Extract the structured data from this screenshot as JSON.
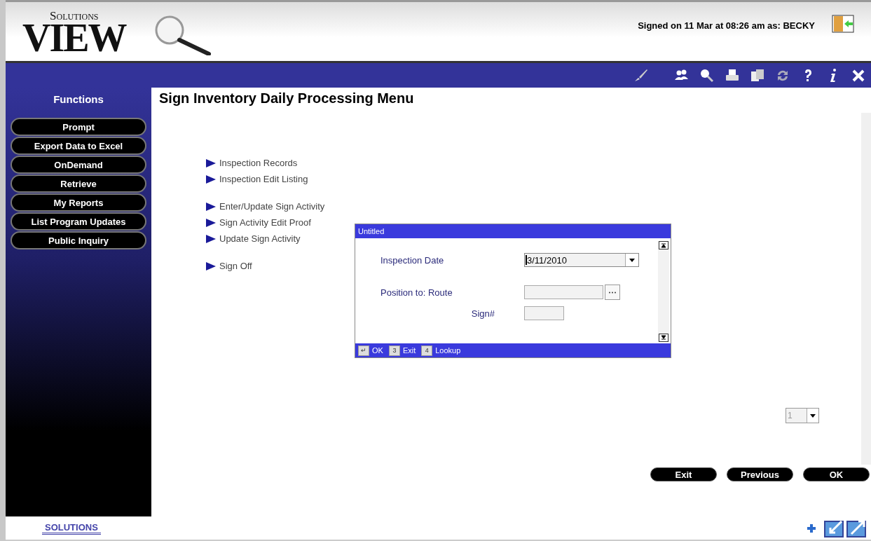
{
  "header": {
    "logo_small": "Solutions",
    "logo_big": "VIEW",
    "signed_on": "Signed on 11 Mar at 08:26 am as: BECKY"
  },
  "sidebar": {
    "title": "Functions",
    "items": [
      "Prompt",
      "Export Data to Excel",
      "OnDemand",
      "Retrieve",
      "My Reports",
      "List Program Updates",
      "Public Inquiry"
    ]
  },
  "page": {
    "title": "Sign Inventory Daily Processing Menu",
    "menu_groups": [
      [
        "Inspection Records",
        "Inspection Edit Listing"
      ],
      [
        "Enter/Update Sign Activity",
        "Sign Activity Edit Proof",
        "Update Sign Activity"
      ],
      [
        "Sign Off"
      ]
    ],
    "page_select": "1",
    "buttons": [
      "Exit",
      "Previous",
      "OK"
    ]
  },
  "dialog": {
    "title": "Untitled",
    "fields": [
      {
        "kind": "dropdown",
        "label": "Inspection Date",
        "value": "3/11/2010"
      },
      {
        "kind": "lookup",
        "label": "Position to: Route"
      },
      {
        "kind": "short",
        "label": "Sign#"
      }
    ],
    "keys": [
      {
        "key": "↵",
        "label": "OK"
      },
      {
        "key": "3",
        "label": "Exit"
      },
      {
        "key": "4",
        "label": "Lookup"
      }
    ]
  },
  "footer": {
    "logo": "SOLUTIONS"
  }
}
